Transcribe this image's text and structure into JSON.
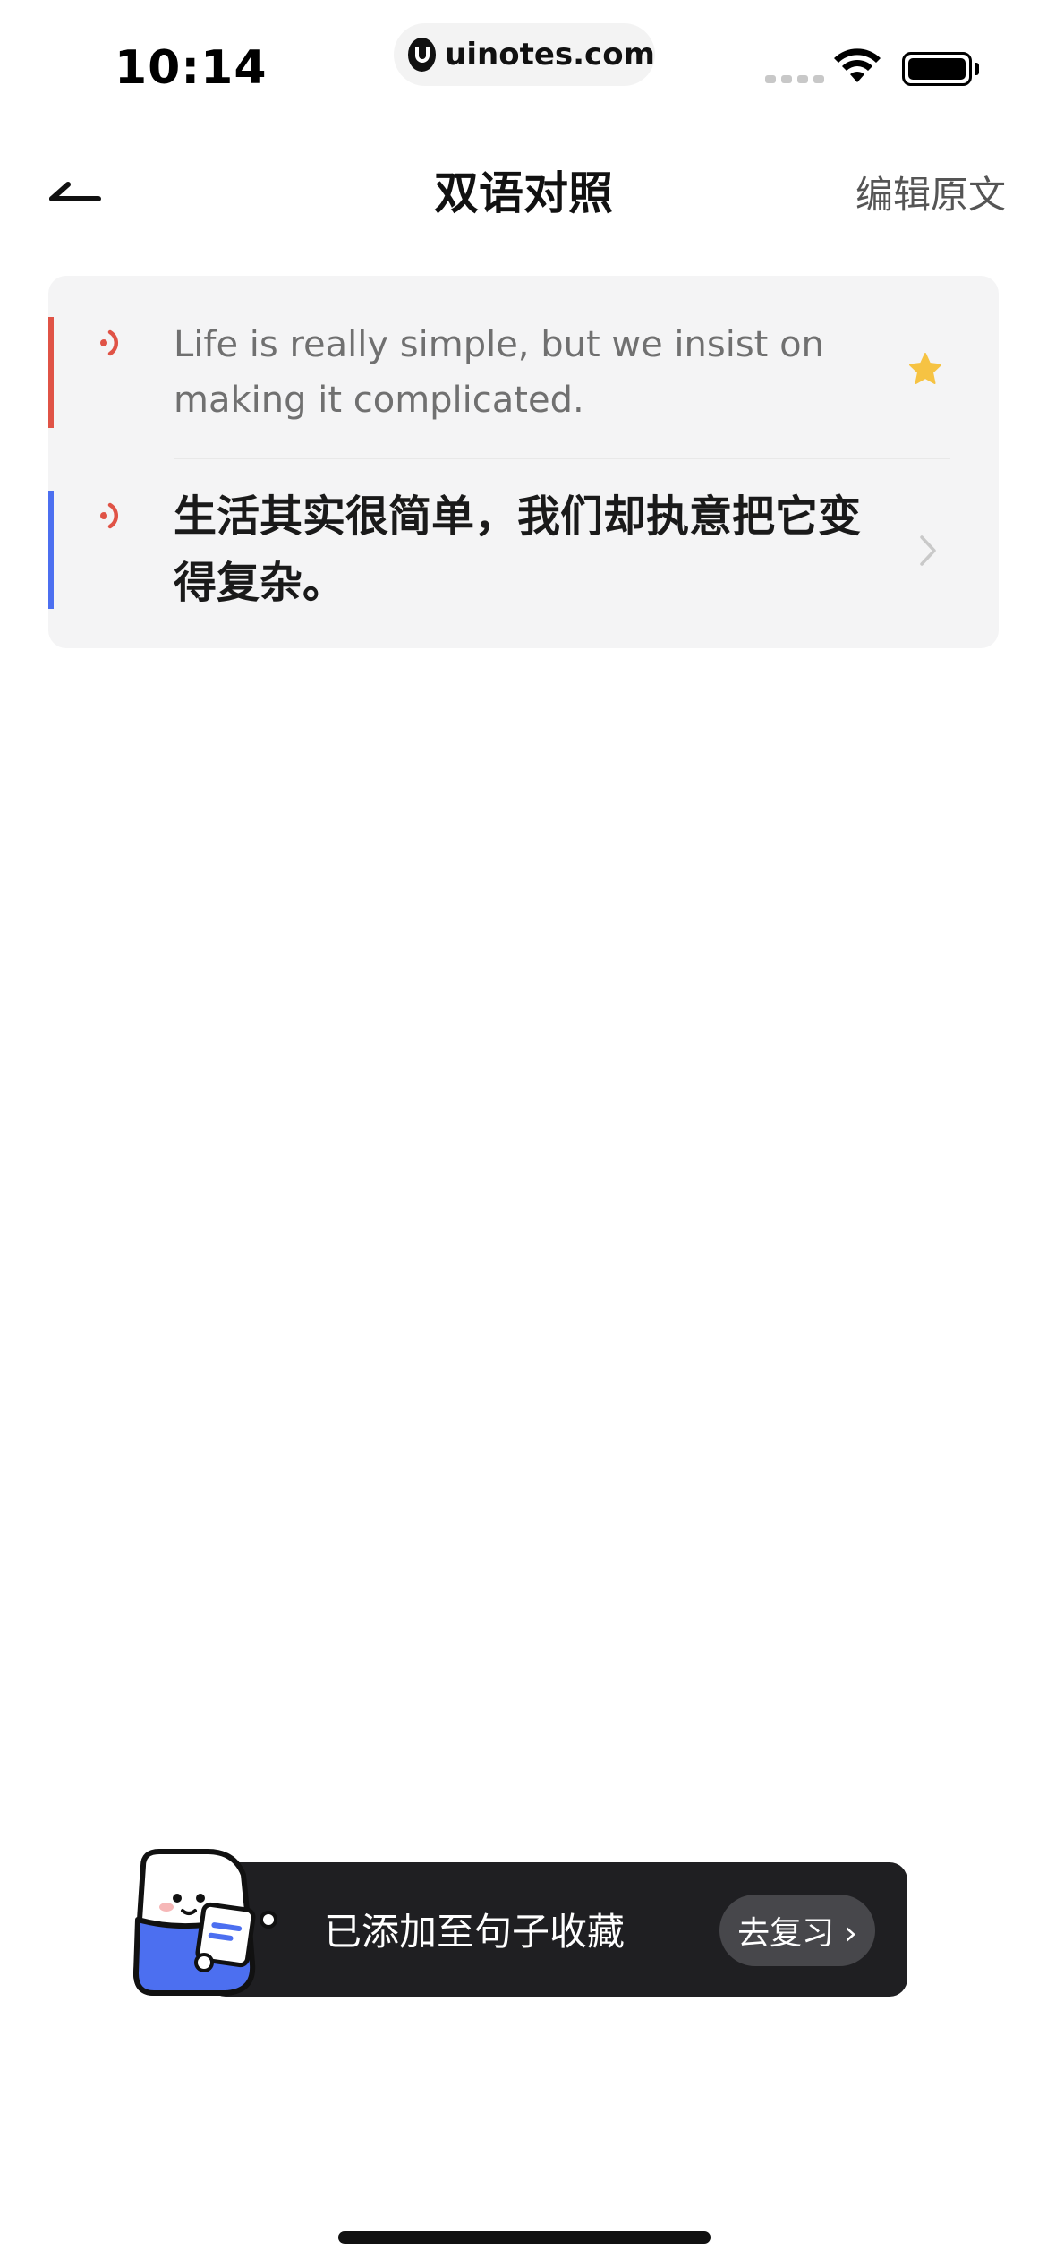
{
  "status_bar": {
    "time": "10:14",
    "url": "uinotes.com"
  },
  "nav": {
    "title": "双语对照",
    "action_label": "编辑原文"
  },
  "sentence": {
    "english": "Life is really simple, but we insist on making it complicated.",
    "chinese": "生活其实很简单，我们却执意把它变得复杂。",
    "starred": true,
    "colors": {
      "english_bar": "#e05346",
      "chinese_bar": "#4c6ff0",
      "star": "#f6c343",
      "speaker": "#e05346"
    }
  },
  "toast": {
    "message": "已添加至句子收藏",
    "button_label": "去复习 ›"
  },
  "icons": {
    "back": "back-arrow-icon",
    "speaker": "speaker-icon",
    "star": "star-icon",
    "chevron": "chevron-right-icon"
  }
}
